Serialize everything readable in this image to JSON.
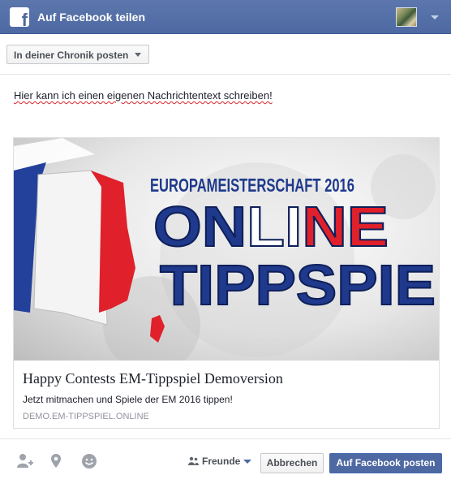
{
  "header": {
    "title": "Auf Facebook teilen",
    "logo_icon": "facebook-f-icon",
    "color": "#4e69a2"
  },
  "audience": {
    "label": "In deiner Chronik posten"
  },
  "composer": {
    "message": "Hier kann ich einen eigenen Nachrichtentext schreiben!"
  },
  "link_preview": {
    "image": {
      "headline": "EUROPAMEISTERSCHAFT 2016",
      "word1": [
        "ON",
        "LI",
        "NE"
      ],
      "word2": "TIPPSPIE",
      "colors": {
        "blue": "#1f3a8c",
        "red": "#e0202a",
        "white": "#ffffff"
      }
    },
    "title": "Happy Contests EM-Tippspiel Demoversion",
    "description": "Jetzt mitmachen und Spiele der EM 2016 tippen!",
    "domain": "DEMO.EM-TIPPSPIEL.ONLINE"
  },
  "footer": {
    "icons": [
      "tag-friends-icon",
      "location-pin-icon",
      "feeling-smiley-icon"
    ],
    "privacy_label": "Freunde",
    "cancel_label": "Abbrechen",
    "post_label": "Auf Facebook posten"
  }
}
